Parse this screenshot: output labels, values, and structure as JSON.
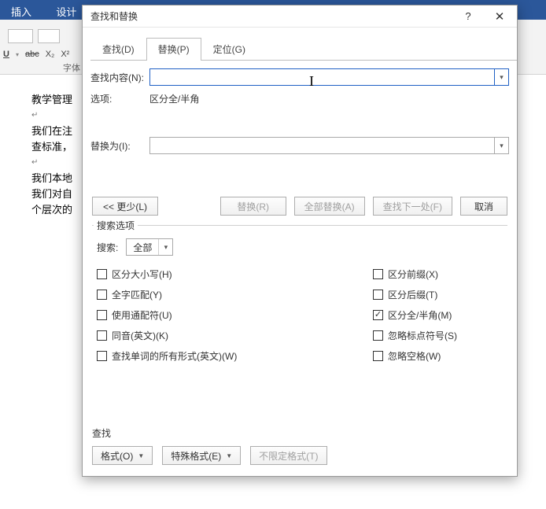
{
  "ribbon": {
    "tabs": [
      "插入",
      "设计"
    ]
  },
  "toolbar": {
    "bold": "U",
    "strike": "abc",
    "sub1": "X₂",
    "sub2": "X²",
    "group_label": "字体"
  },
  "doc_lines": [
    "教学管理",
    "↵",
    "我们在注",
    "查标准，",
    "↵",
    "我们本地",
    "我们对自",
    "个层次的"
  ],
  "dialog": {
    "title": "查找和替换",
    "help": "?",
    "close": "✕",
    "tabs": {
      "find": "查找(D)",
      "replace": "替换(P)",
      "goto": "定位(G)"
    },
    "find_label": "查找内容(N):",
    "options_label": "选项:",
    "options_text": "区分全/半角",
    "replace_label": "替换为(I):",
    "buttons": {
      "less": "<< 更少(L)",
      "replace": "替换(R)",
      "replace_all": "全部替换(A)",
      "find_next": "查找下一处(F)",
      "cancel": "取消"
    },
    "search_options": {
      "legend": "搜索选项",
      "search_label": "搜索:",
      "search_value": "全部",
      "left": [
        {
          "label": "区分大小写(H)",
          "checked": false
        },
        {
          "label": "全字匹配(Y)",
          "checked": false
        },
        {
          "label": "使用通配符(U)",
          "checked": false
        },
        {
          "label": "同音(英文)(K)",
          "checked": false
        },
        {
          "label": "查找单词的所有形式(英文)(W)",
          "checked": false
        }
      ],
      "right": [
        {
          "label": "区分前缀(X)",
          "checked": false
        },
        {
          "label": "区分后缀(T)",
          "checked": false
        },
        {
          "label": "区分全/半角(M)",
          "checked": true
        },
        {
          "label": "忽略标点符号(S)",
          "checked": false
        },
        {
          "label": "忽略空格(W)",
          "checked": false
        }
      ]
    },
    "find_section": {
      "label": "查找",
      "format": "格式(O)",
      "special": "特殊格式(E)",
      "noformat": "不限定格式(T)"
    }
  }
}
